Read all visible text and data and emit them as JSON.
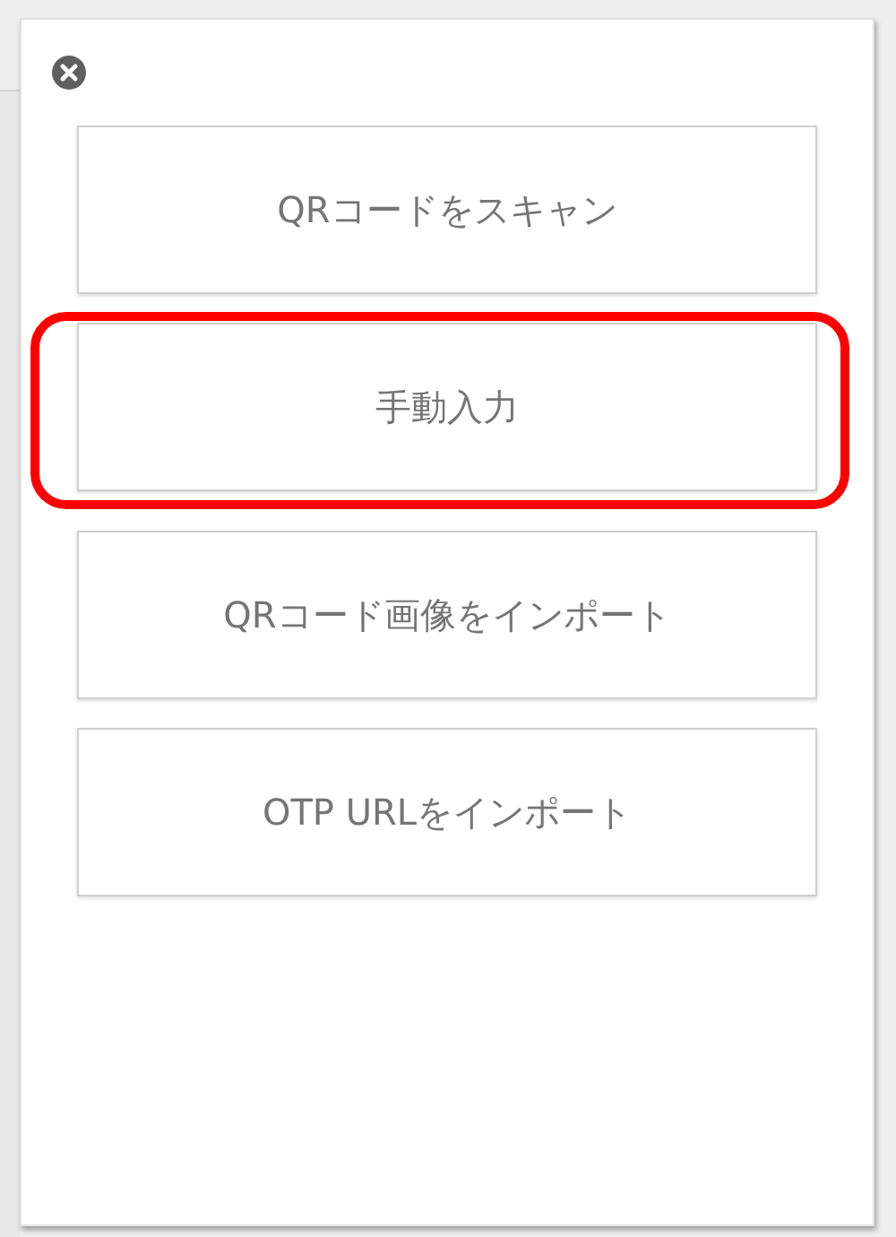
{
  "buttons": [
    {
      "label": "QRコードをスキャン",
      "highlighted": false
    },
    {
      "label": "手動入力",
      "highlighted": true
    },
    {
      "label": "QRコード画像をインポート",
      "highlighted": false
    },
    {
      "label": "OTP URLをインポート",
      "highlighted": false
    }
  ]
}
